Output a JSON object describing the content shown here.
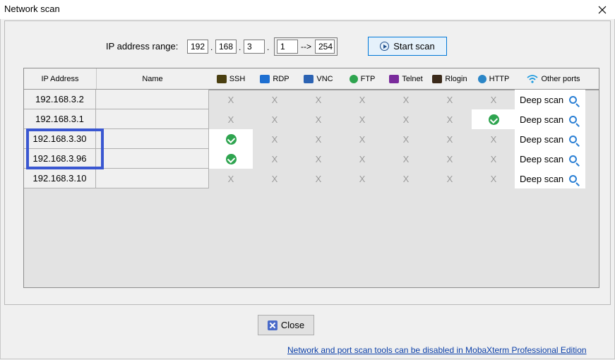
{
  "window": {
    "title": "Network scan"
  },
  "scan_form": {
    "range_label": "IP address range:",
    "octet1": "192",
    "octet2": "168",
    "octet3": "3",
    "range_start": "1",
    "range_arrow": "-->",
    "range_end": "254",
    "start_button": "Start scan"
  },
  "table": {
    "columns": [
      "IP Address",
      "Name",
      "SSH",
      "RDP",
      "VNC",
      "FTP",
      "Telnet",
      "Rlogin",
      "HTTP",
      "Other ports"
    ],
    "service_colors": {
      "ssh": "#4a3f10",
      "rdp": "#1e6fd1",
      "vnc": "#2c63b3",
      "ftp": "#2ea44f",
      "telnet": "#7a2b9c",
      "rlogin": "#3b2a1a",
      "http": "#2b86c7",
      "other": "#1e9be0"
    },
    "miss_mark": "X",
    "deep_scan_label": "Deep scan",
    "rows": [
      {
        "ip": "192.168.3.2",
        "name": "",
        "open": [
          false,
          false,
          false,
          false,
          false,
          false,
          false
        ]
      },
      {
        "ip": "192.168.3.1",
        "name": "",
        "open": [
          false,
          false,
          false,
          false,
          false,
          false,
          true
        ]
      },
      {
        "ip": "192.168.3.30",
        "name": "",
        "open": [
          true,
          false,
          false,
          false,
          false,
          false,
          false
        ]
      },
      {
        "ip": "192.168.3.96",
        "name": "",
        "open": [
          true,
          false,
          false,
          false,
          false,
          false,
          false
        ]
      },
      {
        "ip": "192.168.3.10",
        "name": "",
        "open": [
          false,
          false,
          false,
          false,
          false,
          false,
          false
        ]
      }
    ]
  },
  "footer": {
    "close_button": "Close",
    "link_text": "Network and port scan tools can be disabled in MobaXterm Professional Edition"
  }
}
